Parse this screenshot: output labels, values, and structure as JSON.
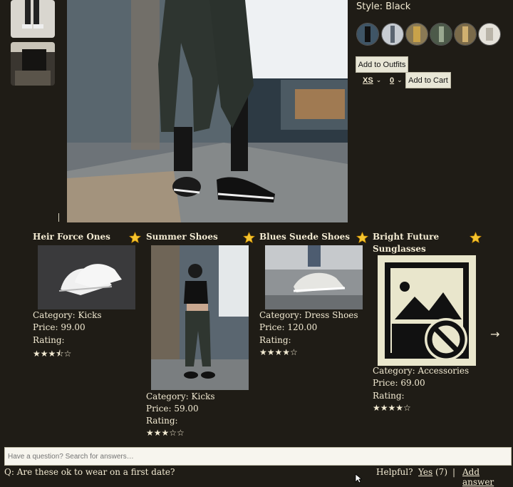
{
  "style": {
    "label": "Style: Black"
  },
  "buttons": {
    "add_outfit": "Add to Outfits",
    "add_cart": "Add to Cart"
  },
  "size_select": {
    "selected": "XS"
  },
  "qty_select": {
    "selected": "0"
  },
  "products": [
    {
      "title": "Heir Force Ones",
      "category": "Category: Kicks",
      "price": "Price: 99.00",
      "rating_label": "Rating:",
      "rating": 3.5,
      "stars": "★★★⯪☆"
    },
    {
      "title": "Summer Shoes",
      "category": "Category: Kicks",
      "price": "Price: 59.00",
      "rating_label": "Rating:",
      "rating": 3,
      "stars": "★★★☆☆"
    },
    {
      "title": "Blues Suede Shoes",
      "category": "Category: Dress Shoes",
      "price": "Price: 120.00",
      "rating_label": "Rating:",
      "rating": 4,
      "stars": "★★★★☆"
    },
    {
      "title": "Bright Future Sunglasses",
      "category": "Category: Accessories",
      "price": "Price: 69.00",
      "rating_label": "Rating:",
      "rating": 4,
      "stars": "★★★★☆"
    }
  ],
  "carousel": {
    "next_icon": "→"
  },
  "qa": {
    "search_placeholder": "Have a question? Search for answers…",
    "question": "Q: Are these ok to wear on a first date?",
    "helpful_label": "Helpful?",
    "yes_label": "Yes",
    "yes_count": "(7)",
    "separator": "|",
    "add_answer": "Add answer"
  },
  "colors": {
    "background": "#1f1c16",
    "text": "#f2ead2",
    "favorite_star": "#f4c430"
  }
}
